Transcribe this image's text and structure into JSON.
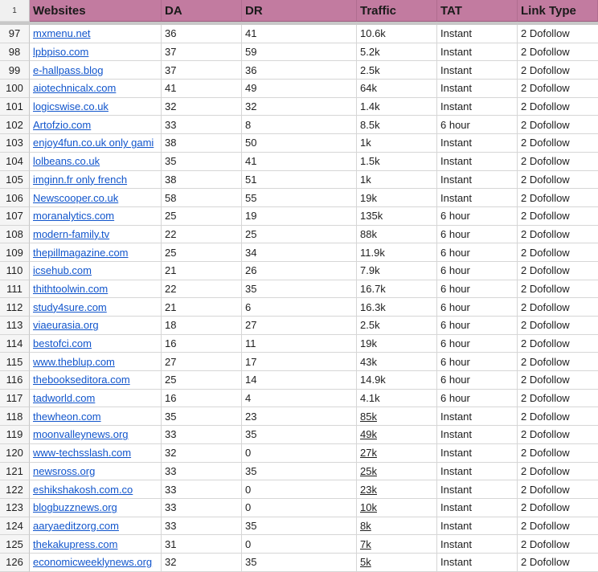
{
  "header": {
    "row_number": "1",
    "columns": [
      "Websites",
      "DA",
      "DR",
      "Traffic",
      "TAT",
      "Link Type"
    ]
  },
  "rows": [
    {
      "n": "97",
      "site": "mxmenu.net",
      "da": "36",
      "dr": "41",
      "traffic": "10.6k",
      "tat": "Instant",
      "link": "2 Dofollow",
      "traffic_underlined": false
    },
    {
      "n": "98",
      "site": "lpbpiso.com",
      "da": "37",
      "dr": "59",
      "traffic": "5.2k",
      "tat": "Instant",
      "link": "2 Dofollow",
      "traffic_underlined": false
    },
    {
      "n": "99",
      "site": "e-hallpass.blog",
      "da": "37",
      "dr": "36",
      "traffic": "2.5k",
      "tat": "Instant",
      "link": "2 Dofollow",
      "traffic_underlined": false
    },
    {
      "n": "100",
      "site": "aiotechnicalx.com",
      "da": "41",
      "dr": "49",
      "traffic": "64k",
      "tat": "Instant",
      "link": "2 Dofollow",
      "traffic_underlined": false
    },
    {
      "n": "101",
      "site": "logicswise.co.uk",
      "da": "32",
      "dr": "32",
      "traffic": "1.4k",
      "tat": "Instant",
      "link": "2 Dofollow",
      "traffic_underlined": false
    },
    {
      "n": "102",
      "site": "Artofzio.com",
      "da": "33",
      "dr": "8",
      "traffic": "8.5k",
      "tat": "6 hour",
      "link": "2 Dofollow",
      "traffic_underlined": false
    },
    {
      "n": "103",
      "site": "enjoy4fun.co.uk  only gami",
      "da": "38",
      "dr": "50",
      "traffic": "1k",
      "tat": "Instant",
      "link": "2 Dofollow",
      "traffic_underlined": false
    },
    {
      "n": "104",
      "site": "lolbeans.co.uk",
      "da": "35",
      "dr": "41",
      "traffic": "1.5k",
      "tat": "Instant",
      "link": "2 Dofollow",
      "traffic_underlined": false
    },
    {
      "n": "105",
      "site": "imginn.fr  only french",
      "da": "38",
      "dr": "51",
      "traffic": "1k",
      "tat": "Instant",
      "link": "2 Dofollow",
      "traffic_underlined": false
    },
    {
      "n": "106",
      "site": "Newscooper.co.uk",
      "da": "58",
      "dr": "55",
      "traffic": "19k",
      "tat": "Instant",
      "link": "2 Dofollow",
      "traffic_underlined": false
    },
    {
      "n": "107",
      "site": "moranalytics.com",
      "da": "25",
      "dr": "19",
      "traffic": "135k",
      "tat": "6 hour",
      "link": "2 Dofollow",
      "traffic_underlined": false
    },
    {
      "n": "108",
      "site": "modern-family.tv",
      "da": "22",
      "dr": "25",
      "traffic": "88k",
      "tat": "6 hour",
      "link": "2 Dofollow",
      "traffic_underlined": false
    },
    {
      "n": "109",
      "site": "thepillmagazine.com",
      "da": "25",
      "dr": "34",
      "traffic": "11.9k",
      "tat": "6 hour",
      "link": "2 Dofollow",
      "traffic_underlined": false
    },
    {
      "n": "110",
      "site": "icsehub.com",
      "da": "21",
      "dr": "26",
      "traffic": "7.9k",
      "tat": "6 hour",
      "link": "2 Dofollow",
      "traffic_underlined": false
    },
    {
      "n": "111",
      "site": "thithtoolwin.com",
      "da": "22",
      "dr": "35",
      "traffic": "16.7k",
      "tat": "6 hour",
      "link": "2 Dofollow",
      "traffic_underlined": false
    },
    {
      "n": "112",
      "site": "study4sure.com",
      "da": "21",
      "dr": "6",
      "traffic": "16.3k",
      "tat": "6 hour",
      "link": "2 Dofollow",
      "traffic_underlined": false
    },
    {
      "n": "113",
      "site": "viaeurasia.org",
      "da": "18",
      "dr": "27",
      "traffic": "2.5k",
      "tat": "6 hour",
      "link": "2 Dofollow",
      "traffic_underlined": false
    },
    {
      "n": "114",
      "site": "bestofci.com",
      "da": "16",
      "dr": "11",
      "traffic": "19k",
      "tat": "6 hour",
      "link": "2 Dofollow",
      "traffic_underlined": false
    },
    {
      "n": "115",
      "site": "www.theblup.com",
      "da": "27",
      "dr": "17",
      "traffic": "43k",
      "tat": "6 hour",
      "link": "2 Dofollow",
      "traffic_underlined": false
    },
    {
      "n": "116",
      "site": "thebookseditora.com",
      "da": "25",
      "dr": "14",
      "traffic": "14.9k",
      "tat": "6 hour",
      "link": "2 Dofollow",
      "traffic_underlined": false
    },
    {
      "n": "117",
      "site": "tadworld.com",
      "da": "16",
      "dr": "4",
      "traffic": "4.1k",
      "tat": "6 hour",
      "link": "2 Dofollow",
      "traffic_underlined": false
    },
    {
      "n": "118",
      "site": "thewheon.com",
      "da": "35",
      "dr": "23",
      "traffic": "85k",
      "tat": "Instant",
      "link": "2 Dofollow",
      "traffic_underlined": true
    },
    {
      "n": "119",
      "site": "moonvalleynews.org",
      "da": "33",
      "dr": "35",
      "traffic": "49k",
      "tat": "Instant",
      "link": "2 Dofollow",
      "traffic_underlined": true
    },
    {
      "n": "120",
      "site": "www-techsslash.com",
      "da": "32",
      "dr": "0",
      "traffic": "27k",
      "tat": "Instant",
      "link": "2 Dofollow",
      "traffic_underlined": true
    },
    {
      "n": "121",
      "site": "newsross.org",
      "da": "33",
      "dr": "35",
      "traffic": "25k",
      "tat": "Instant",
      "link": "2 Dofollow",
      "traffic_underlined": true
    },
    {
      "n": "122",
      "site": "eshikshakosh.com.co",
      "da": "33",
      "dr": "0",
      "traffic": "23k",
      "tat": "Instant",
      "link": "2 Dofollow",
      "traffic_underlined": true
    },
    {
      "n": "123",
      "site": "blogbuzznews.org",
      "da": "33",
      "dr": "0",
      "traffic": "10k",
      "tat": "Instant",
      "link": "2 Dofollow",
      "traffic_underlined": true
    },
    {
      "n": "124",
      "site": "aaryaeditzorg.com",
      "da": "33",
      "dr": "35",
      "traffic": "8k",
      "tat": "Instant",
      "link": "2 Dofollow",
      "traffic_underlined": true
    },
    {
      "n": "125",
      "site": "thekakupress.com",
      "da": "31",
      "dr": "0",
      "traffic": "7k",
      "tat": "Instant",
      "link": "2 Dofollow",
      "traffic_underlined": true
    },
    {
      "n": "126",
      "site": "economicweeklynews.org",
      "da": "32",
      "dr": "35",
      "traffic": "5k",
      "tat": "Instant",
      "link": "2 Dofollow",
      "traffic_underlined": true
    }
  ],
  "colors": {
    "header_bg": "#c27ba0",
    "link_text": "#1155cc",
    "grid": "#d6d6d6"
  }
}
